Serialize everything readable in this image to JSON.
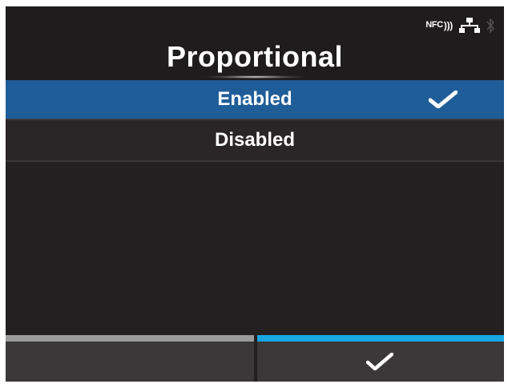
{
  "status": {
    "nfc_label": "NFC",
    "icons": [
      "nfc-icon",
      "network-icon",
      "bluetooth-icon"
    ]
  },
  "title": "Proportional",
  "options": [
    {
      "label": "Enabled",
      "selected": true
    },
    {
      "label": "Disabled",
      "selected": false
    }
  ],
  "softkeys": {
    "left": "",
    "right": "confirm-check-icon"
  },
  "colors": {
    "background": "#232021",
    "selected": "#1f5d99",
    "accent": "#19a8e5",
    "left_bar": "#9b9b9b"
  }
}
